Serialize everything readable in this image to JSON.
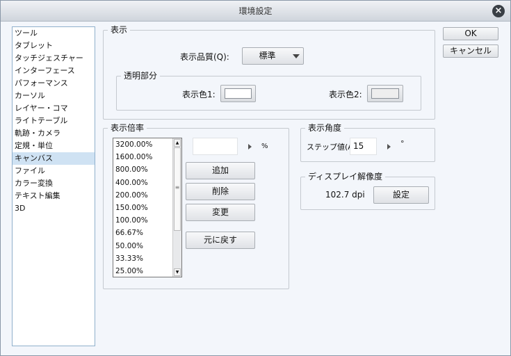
{
  "title": "環境設定",
  "sidebar": {
    "items": [
      "ツール",
      "タブレット",
      "タッチジェスチャー",
      "インターフェース",
      "パフォーマンス",
      "カーソル",
      "レイヤー・コマ",
      "ライトテーブル",
      "軌跡・カメラ",
      "定規・単位",
      "キャンバス",
      "ファイル",
      "カラー変換",
      "テキスト編集",
      "3D"
    ],
    "selected": "キャンバス"
  },
  "display": {
    "label": "表示",
    "quality_label": "表示品質(Q):",
    "quality_value": "標準",
    "transparent": {
      "label": "透明部分",
      "color1_label": "表示色1:",
      "color2_label": "表示色2:",
      "color1": "#ffffff",
      "color2": "#eeeeee"
    }
  },
  "zoom": {
    "label": "表示倍率",
    "levels": [
      "3200.00%",
      "1600.00%",
      "800.00%",
      "400.00%",
      "200.00%",
      "150.00%",
      "100.00%",
      "66.67%",
      "50.00%",
      "33.33%",
      "25.00%"
    ],
    "input_value": "",
    "unit": "%",
    "add": "追加",
    "delete": "削除",
    "change": "変更",
    "reset": "元に戻す"
  },
  "angle": {
    "label": "表示角度",
    "step_label": "ステップ値(A):",
    "step_value": "15",
    "unit": "°"
  },
  "resolution": {
    "label": "ディスプレイ解像度",
    "value": "102.7 dpi",
    "set": "設定"
  },
  "buttons": {
    "ok": "OK",
    "cancel": "キャンセル"
  }
}
